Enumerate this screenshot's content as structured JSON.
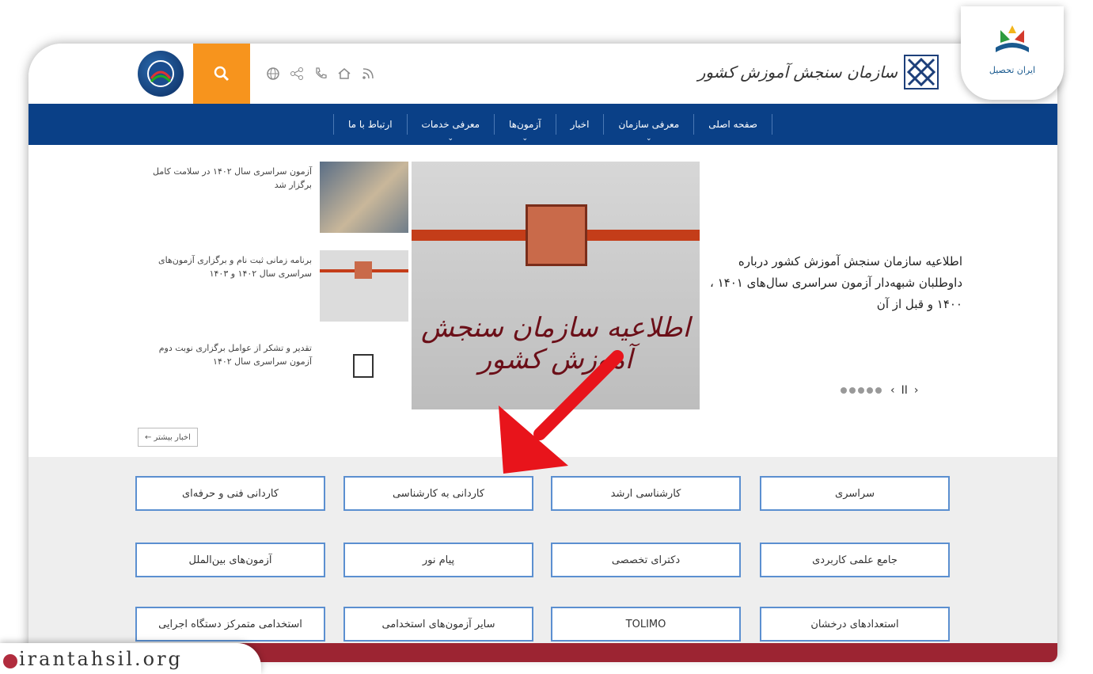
{
  "header": {
    "logo_text": "سازمان سنجش آموزش کشور",
    "emblem_text": "",
    "icons": [
      "search-icon",
      "globe-icon",
      "share-icon",
      "phone-icon",
      "home-icon",
      "rss-icon"
    ]
  },
  "nav": {
    "items": [
      {
        "label": "صفحه اصلی"
      },
      {
        "label": "معرفی سازمان"
      },
      {
        "label": "اخبار"
      },
      {
        "label": "آزمون‌ها"
      },
      {
        "label": "معرفی خدمات"
      },
      {
        "label": "ارتباط با ما"
      }
    ]
  },
  "news": {
    "headline": "اطلاعیه سازمان سنجش آموزش کشور درباره داوطلبان شبهه‌دار آزمون سراسری سال‌های ۱۴۰۱ ، ۱۴۰۰ و قبل از آن",
    "image_caption": "اطلاعیه سازمان سنجش آموزش کشور",
    "side": [
      {
        "text": "آزمون سراسری سال ۱۴۰۲ در سلامت کامل برگزار شد"
      },
      {
        "text": "برنامه زمانی ثبت نام و برگزاری آزمون‌های سراسری سال ۱۴۰۲ و ۱۴۰۳"
      },
      {
        "text": "تقدیر و تشکر از عوامل برگزاری نوبت دوم آزمون سراسری سال ۱۴۰۲"
      }
    ],
    "more_label": "اخبار بیشتر ←"
  },
  "exams": {
    "row1": [
      "سراسری",
      "کارشناسی ارشد",
      "کاردانی به کارشناسی",
      "کاردانی فنی و حرفه‌ای"
    ],
    "row2": [
      "جامع علمی کاربردی",
      "دکترای تخصصی",
      "پیام نور",
      "آزمون‌های بین‌الملل"
    ],
    "row3": [
      "استعدادهای درخشان",
      "TOLIMO",
      "سایر آزمون‌های استخدامی",
      "استخدامی متمرکز دستگاه اجرایی"
    ]
  },
  "branding": {
    "badge_text": "ایران تحصیل",
    "site_url": "irantahsil.org"
  },
  "colors": {
    "nav_bg": "#0a4087",
    "search_bg": "#f7941d",
    "accent_red": "#9c2432",
    "button_border": "#5b8fd0"
  }
}
